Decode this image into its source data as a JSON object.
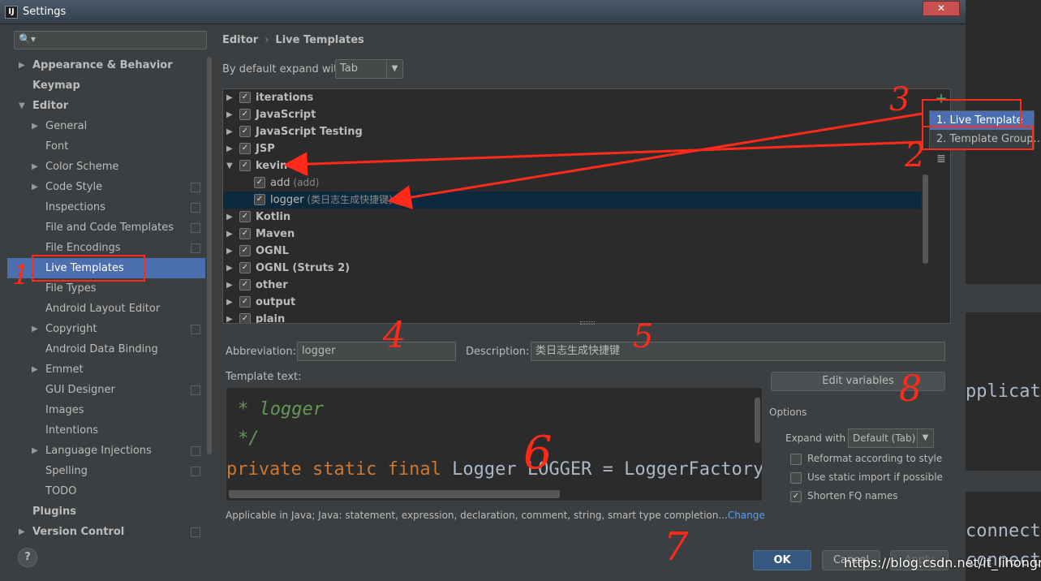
{
  "window": {
    "title": "Settings",
    "close_glyph": "✕",
    "app_icon_letter": "IJ"
  },
  "sidebar": {
    "search_placeholder": "",
    "search_icon": "search-icon",
    "items": [
      {
        "label": "Appearance & Behavior",
        "bold": true,
        "arrow": "▶"
      },
      {
        "label": "Keymap",
        "bold": true
      },
      {
        "label": "Editor",
        "bold": true,
        "arrow": "▼"
      },
      {
        "label": "General",
        "arrow": "▶"
      },
      {
        "label": "Font"
      },
      {
        "label": "Color Scheme",
        "arrow": "▶"
      },
      {
        "label": "Code Style",
        "arrow": "▶",
        "icon": true
      },
      {
        "label": "Inspections",
        "icon": true
      },
      {
        "label": "File and Code Templates",
        "icon": true
      },
      {
        "label": "File Encodings",
        "icon": true
      },
      {
        "label": "Live Templates",
        "selected": true
      },
      {
        "label": "File Types"
      },
      {
        "label": "Android Layout Editor"
      },
      {
        "label": "Copyright",
        "arrow": "▶",
        "icon": true
      },
      {
        "label": "Android Data Binding"
      },
      {
        "label": "Emmet",
        "arrow": "▶"
      },
      {
        "label": "GUI Designer",
        "icon": true
      },
      {
        "label": "Images"
      },
      {
        "label": "Intentions"
      },
      {
        "label": "Language Injections",
        "arrow": "▶",
        "icon": true
      },
      {
        "label": "Spelling",
        "icon": true
      },
      {
        "label": "TODO"
      },
      {
        "label": "Plugins",
        "bold": true
      },
      {
        "label": "Version Control",
        "bold": true,
        "arrow": "▶",
        "icon": true
      }
    ]
  },
  "breadcrumb": {
    "part1": "Editor",
    "sep": "›",
    "part2": "Live Templates"
  },
  "expand": {
    "label": "By default expand with",
    "value": "Tab",
    "dropdown": "▼"
  },
  "templates": [
    {
      "label": "iterations",
      "group": true,
      "expanded": false
    },
    {
      "label": "JavaScript",
      "group": true
    },
    {
      "label": "JavaScript Testing",
      "group": true
    },
    {
      "label": "JSP",
      "group": true
    },
    {
      "label": "kevin",
      "group": true,
      "expanded": true
    },
    {
      "label": "add",
      "desc": "(add)",
      "group": false
    },
    {
      "label": "logger",
      "desc": "(类日志生成快捷键)",
      "group": false,
      "selected": true
    },
    {
      "label": "Kotlin",
      "group": true
    },
    {
      "label": "Maven",
      "group": true
    },
    {
      "label": "OGNL",
      "group": true
    },
    {
      "label": "OGNL (Struts 2)",
      "group": true
    },
    {
      "label": "other",
      "group": true
    },
    {
      "label": "output",
      "group": true
    },
    {
      "label": "plain",
      "group": true
    }
  ],
  "toolbar": {
    "add_icon": "+",
    "list_icon": "≣"
  },
  "popup": {
    "item1": "1. Live Template",
    "item2": "2. Template Group..."
  },
  "form": {
    "abbr_label": "Abbreviation:",
    "abbr_value": "logger",
    "desc_label": "Description:",
    "desc_value": "类日志生成快捷键",
    "template_label": "Template text:"
  },
  "editor": {
    "line1": "* logger",
    "line2": "*/",
    "kw": "private static final",
    "rest": " Logger LOGGER = LoggerFactory."
  },
  "edit_variables": "Edit variables",
  "options": {
    "title": "Options",
    "expand_label": "Expand with",
    "expand_value": "Default (Tab)",
    "reformat": "Reformat according to style",
    "static_import": "Use static import if possible",
    "shorten": "Shorten FQ names"
  },
  "applicable": {
    "text": "Applicable in Java; Java: statement, expression, declaration, comment, string, smart type completion...",
    "link": "Change"
  },
  "help": "?",
  "buttons": {
    "ok": "OK",
    "cancel": "Cancel",
    "apply": "Apply"
  },
  "background": {
    "t1": "pplicat",
    "t2": "connect",
    "t3": "connect"
  },
  "watermark": "https://blog.csdn.net/it_lihongmin",
  "annotations": {
    "n1": "1",
    "n2": "2",
    "n3": "3",
    "n4": "4",
    "n5": "5",
    "n6": "6",
    "n7": "7",
    "n8": "8"
  },
  "colors": {
    "accent": "#4b6eaf",
    "annotation": "#ff2a1a",
    "ok": "#365880"
  }
}
